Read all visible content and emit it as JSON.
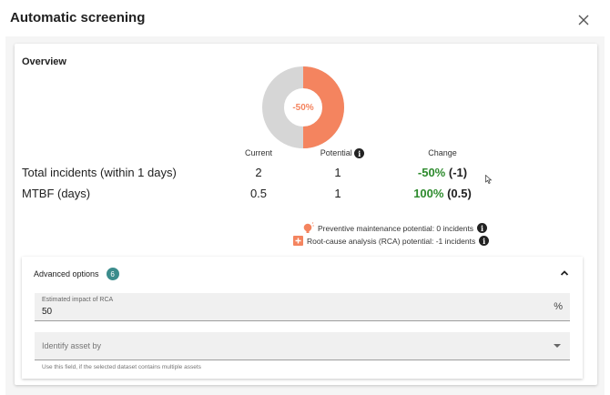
{
  "dialog": {
    "title": "Automatic screening"
  },
  "overview": {
    "title": "Overview",
    "donut": {
      "label": "-50%",
      "change_fraction": 0.5,
      "colors": {
        "reduced": "#f4845f",
        "remaining": "#d6d6d6"
      }
    },
    "columns": {
      "current": "Current",
      "potential": "Potential",
      "change": "Change"
    },
    "rows": [
      {
        "label": "Total incidents (within 1 days)",
        "current": "2",
        "potential": "1",
        "change_pct": "-50%",
        "change_abs": "(-1)"
      },
      {
        "label": "MTBF (days)",
        "current": "0.5",
        "potential": "1",
        "change_pct": "100%",
        "change_abs": "(0.5)"
      }
    ],
    "potentials": {
      "pm": "Preventive maintenance potential: 0 incidents",
      "rca": "Root-cause analysis (RCA) potential: -1 incidents"
    }
  },
  "advanced": {
    "title": "Advanced options",
    "badge": "6",
    "rca_field": {
      "label": "Estimated impact of RCA",
      "value": "50",
      "suffix": "%"
    },
    "asset_field": {
      "placeholder": "Identify asset by"
    },
    "helper": "Use this field, if the selected dataset contains multiple assets"
  },
  "colors": {
    "positive_change": "#2e8b2e",
    "badge": "#3b8c8c",
    "accent": "#f4845f"
  }
}
